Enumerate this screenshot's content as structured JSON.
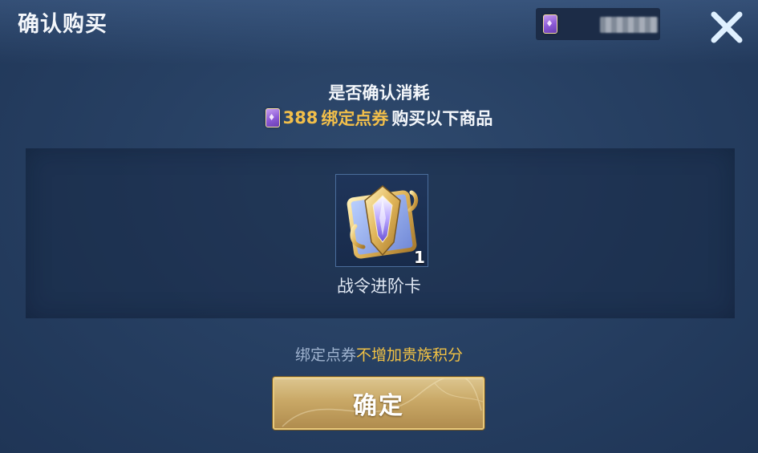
{
  "window": {
    "title": "确认购买"
  },
  "currency": {
    "icon": "voucher-ticket-icon",
    "value_obscured": "00000"
  },
  "prompt": {
    "line1": "是否确认消耗",
    "amount": "388",
    "currency_name": "绑定点券",
    "line2_suffix": "购买以下商品"
  },
  "item": {
    "name": "战令进阶卡",
    "quantity": "1",
    "icon": "battle-pass-card-icon"
  },
  "note": {
    "prefix": "绑定点券",
    "highlight": "不增加贵族积分"
  },
  "confirm": {
    "label": "确定"
  },
  "colors": {
    "accent_gold": "#f2bf4a",
    "background": "#274063",
    "button_gold": "#c9a866"
  }
}
